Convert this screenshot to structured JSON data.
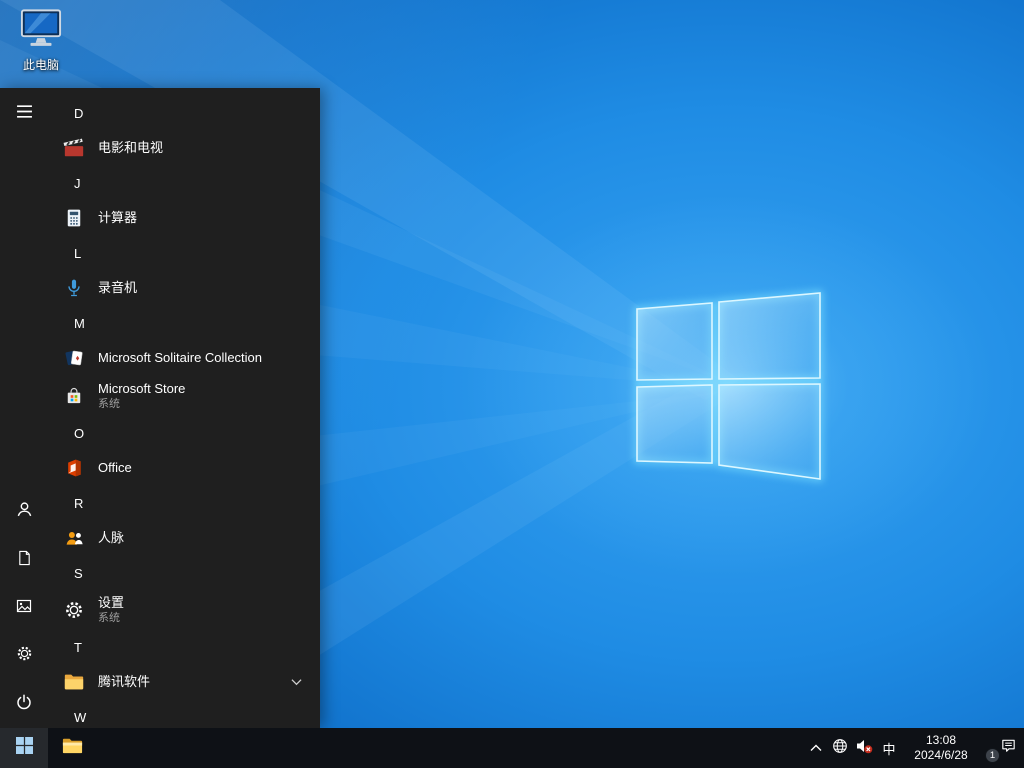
{
  "desktop": {
    "icons": [
      {
        "label": "此电脑",
        "icon": "this-pc"
      }
    ]
  },
  "start_menu": {
    "rail_items": [
      {
        "name": "menu",
        "icon": "hamburger-icon"
      },
      {
        "name": "user",
        "icon": "user-icon"
      },
      {
        "name": "documents",
        "icon": "document-icon"
      },
      {
        "name": "pictures",
        "icon": "pictures-icon"
      },
      {
        "name": "settings",
        "icon": "gear-icon"
      },
      {
        "name": "power",
        "icon": "power-icon"
      }
    ],
    "sections": [
      {
        "letter": "D",
        "apps": [
          {
            "label": "电影和电视",
            "icon": "movies-tv"
          }
        ]
      },
      {
        "letter": "J",
        "apps": [
          {
            "label": "计算器",
            "icon": "calculator"
          }
        ]
      },
      {
        "letter": "L",
        "apps": [
          {
            "label": "录音机",
            "icon": "voice-recorder"
          }
        ]
      },
      {
        "letter": "M",
        "apps": [
          {
            "label": "Microsoft Solitaire Collection",
            "icon": "solitaire"
          },
          {
            "label": "Microsoft Store",
            "sublabel": "系统",
            "icon": "store"
          }
        ]
      },
      {
        "letter": "O",
        "apps": [
          {
            "label": "Office",
            "icon": "office"
          }
        ]
      },
      {
        "letter": "R",
        "apps": [
          {
            "label": "人脉",
            "icon": "people"
          }
        ]
      },
      {
        "letter": "S",
        "apps": [
          {
            "label": "设置",
            "sublabel": "系统",
            "icon": "settings"
          }
        ]
      },
      {
        "letter": "T",
        "apps": [
          {
            "label": "腾讯软件",
            "icon": "folder",
            "expandable": true
          }
        ]
      },
      {
        "letter": "W",
        "apps": []
      }
    ]
  },
  "taskbar": {
    "tray": {
      "ime_label": "中",
      "time": "13:08",
      "date": "2024/6/28",
      "notification_count": "1"
    }
  },
  "colors": {
    "accent": "#0078d7",
    "menu_bg": "#1f1f1f",
    "taskbar_bg": "#0e1116",
    "wallpaper_base": "#1f8ce4"
  }
}
